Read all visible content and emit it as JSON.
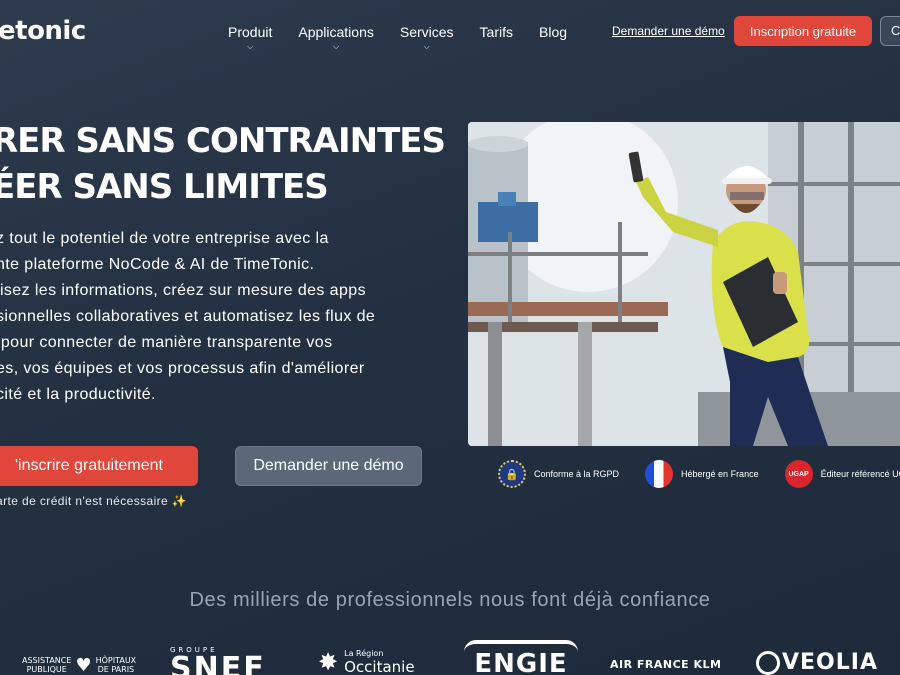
{
  "header": {
    "logo": "etonic",
    "nav": [
      {
        "label": "Produit",
        "has_dropdown": true
      },
      {
        "label": "Applications",
        "has_dropdown": true
      },
      {
        "label": "Services",
        "has_dropdown": true
      },
      {
        "label": "Tarifs",
        "has_dropdown": false
      },
      {
        "label": "Blog",
        "has_dropdown": false
      }
    ],
    "demo_link": "Demander une démo",
    "signup_button": "Inscription gratuite",
    "extra_button": "C"
  },
  "hero": {
    "title_line1": "RER SANS CONTRAINTES",
    "title_line2": "ÉER SANS LIMITES",
    "paragraph": [
      "z tout le potentiel de votre entreprise avec la",
      "nte plateforme NoCode & AI de TimeTonic.",
      "lisez les informations, créez sur mesure des apps",
      "sionnelles collaboratives et automatisez les flux de",
      " pour connecter de manière transparente vos",
      "es, vos équipes et vos processus afin d'améliorer",
      "cité et la productivité."
    ],
    "primary_button": "'inscrire gratuitement",
    "secondary_button": "Demander une démo",
    "no_card_note": "arte de crédit n'est nécessaire ✨"
  },
  "badges": [
    {
      "label": "Conforme à la RGPD",
      "icon": "eu-lock-icon"
    },
    {
      "label": "Hébergé en France",
      "icon": "france-flag-icon"
    },
    {
      "label": "Éditeur référencé UGA",
      "icon": "ugap-icon",
      "icon_text": "UGAP"
    }
  ],
  "trust": {
    "heading": "Des milliers de professionnels nous font déjà confiance",
    "logos": [
      {
        "line1": "ASSISTANCE",
        "line2": "PUBLIQUE",
        "line3": "HÔPITAUX",
        "line4": "DE PARIS"
      },
      {
        "top": "GROUPE",
        "main": "SNEF"
      },
      {
        "top": "La Région",
        "main": "Occitanie"
      },
      {
        "main": "ENGIE"
      },
      {
        "main": "AIR FRANCE KLM"
      },
      {
        "main": "VEOLIA"
      }
    ]
  },
  "colors": {
    "accent": "#e0473a",
    "secondary": "#5c6778",
    "background": "#243142"
  }
}
